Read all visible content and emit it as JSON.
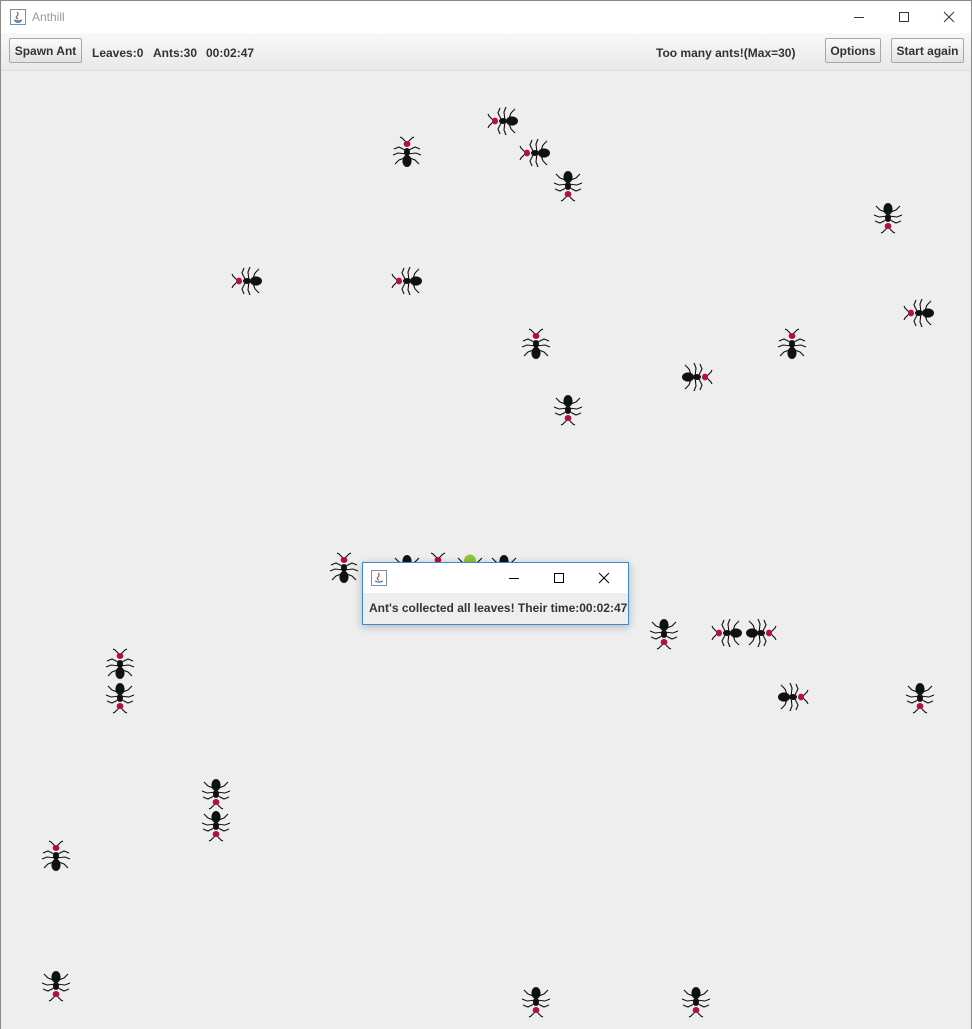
{
  "window": {
    "title": "Anthill"
  },
  "toolbar": {
    "spawn_label": "Spawn Ant",
    "leaves_text": "Leaves:0",
    "ants_text": "Ants:30",
    "timer_text": "00:02:47",
    "status_text": "Too many ants!(Max=30)",
    "options_label": "Options",
    "start_again_label": "Start again"
  },
  "dialog": {
    "title": "",
    "message": "Ant's collected all leaves! Their time:00:02:47"
  },
  "colors": {
    "ant_body": "#111111",
    "ant_head": "#b0103a",
    "ant_carrying_leaf": "#8fc43c",
    "ant_queen": "#f0c020"
  },
  "ants": [
    {
      "id": 1,
      "dir": "left"
    },
    {
      "id": 2,
      "dir": "up"
    },
    {
      "id": 3,
      "dir": "left"
    },
    {
      "id": 4,
      "dir": "down"
    },
    {
      "id": 5,
      "dir": "down"
    },
    {
      "id": 6,
      "dir": "left"
    },
    {
      "id": 7,
      "dir": "left"
    },
    {
      "id": 8,
      "dir": "left"
    },
    {
      "id": 9,
      "dir": "up"
    },
    {
      "id": 10,
      "dir": "up"
    },
    {
      "id": 11,
      "dir": "right"
    },
    {
      "id": 12,
      "dir": "down"
    },
    {
      "id": 13,
      "dir": "up"
    },
    {
      "id": 14,
      "dir": "down"
    },
    {
      "id": 15,
      "dir": "left"
    },
    {
      "id": 16,
      "dir": "right"
    },
    {
      "id": 17,
      "dir": "up"
    },
    {
      "id": 18,
      "dir": "down"
    },
    {
      "id": 19,
      "dir": "right"
    },
    {
      "id": 20,
      "dir": "down"
    },
    {
      "id": 21,
      "dir": "down"
    },
    {
      "id": 22,
      "dir": "down"
    },
    {
      "id": 23,
      "dir": "up"
    },
    {
      "id": 24,
      "dir": "down"
    },
    {
      "id": 25,
      "dir": "down"
    },
    {
      "id": 26,
      "dir": "down"
    },
    {
      "id": 27,
      "dir": "down"
    },
    {
      "id": 28,
      "dir": "up"
    },
    {
      "id": 29,
      "dir": "down",
      "carrying_leaf": true
    },
    {
      "id": 30,
      "dir": "down"
    }
  ]
}
